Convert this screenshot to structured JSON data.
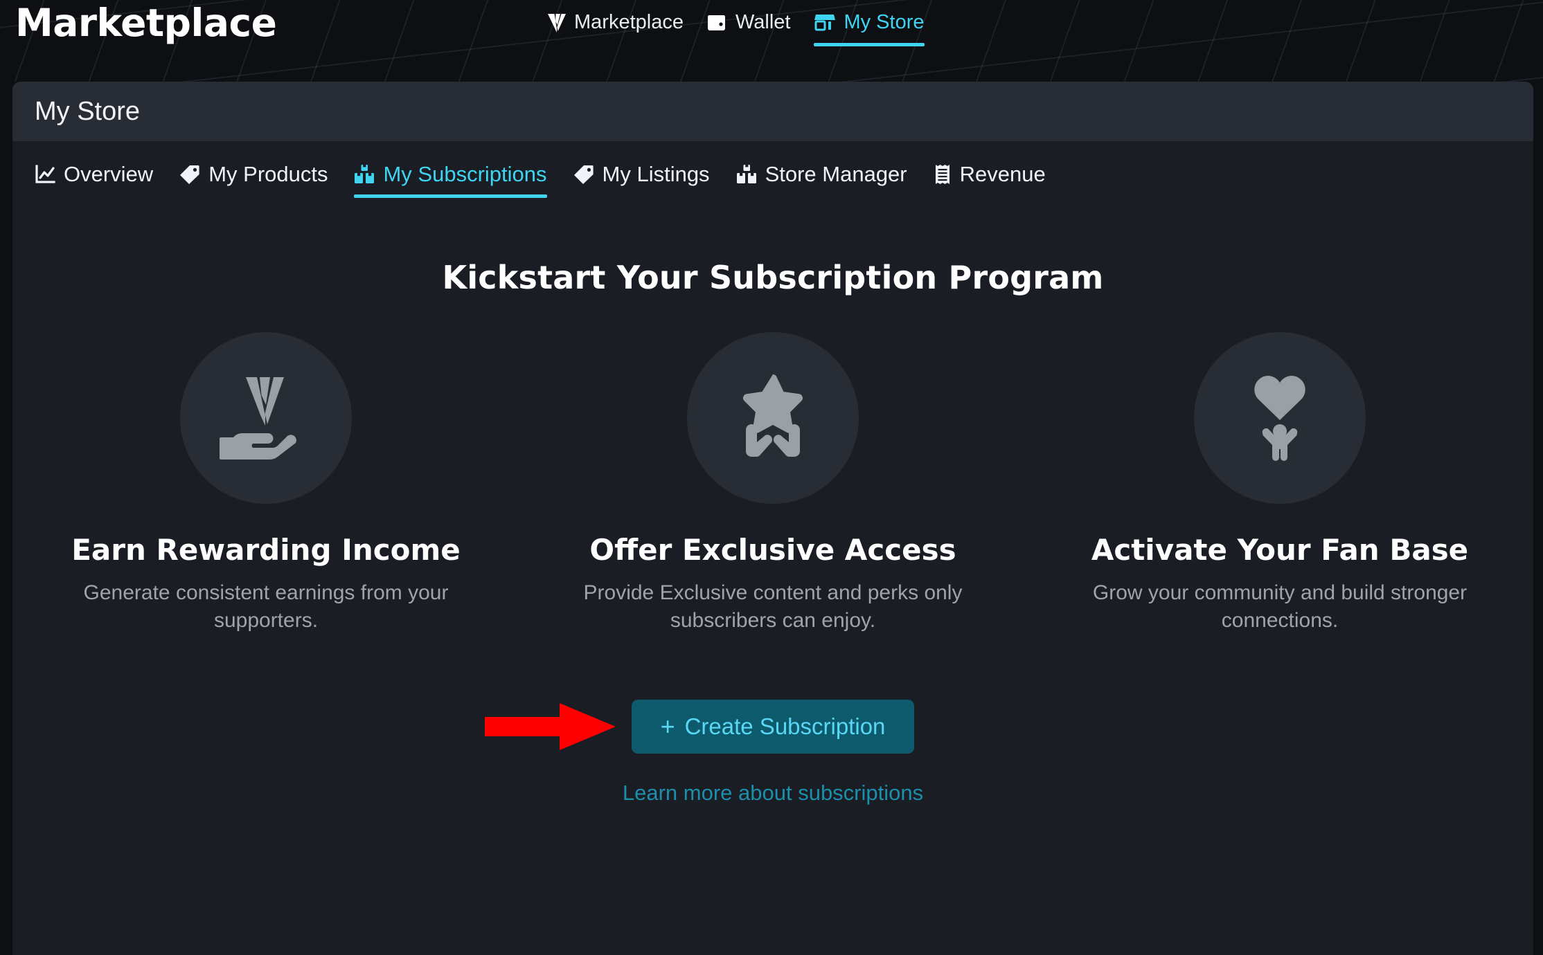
{
  "header": {
    "brand": "Marketplace",
    "nav": [
      {
        "label": "Marketplace",
        "icon": "v-logo-icon",
        "active": false
      },
      {
        "label": "Wallet",
        "icon": "wallet-icon",
        "active": false
      },
      {
        "label": "My Store",
        "icon": "storefront-icon",
        "active": true
      }
    ]
  },
  "panel": {
    "title": "My Store",
    "tabs": [
      {
        "label": "Overview",
        "icon": "chart-line-icon",
        "active": false
      },
      {
        "label": "My Products",
        "icon": "tag-icon",
        "active": false
      },
      {
        "label": "My Subscriptions",
        "icon": "boxes-icon",
        "active": true
      },
      {
        "label": "My Listings",
        "icon": "tag-icon",
        "active": false
      },
      {
        "label": "Store Manager",
        "icon": "boxes-icon",
        "active": false
      },
      {
        "label": "Revenue",
        "icon": "receipt-icon",
        "active": false
      }
    ]
  },
  "hero": {
    "title": "Kickstart Your Subscription Program",
    "features": [
      {
        "icon": "hand-holding-v-icon",
        "title": "Earn Rewarding Income",
        "desc": "Generate consistent earnings from your supporters."
      },
      {
        "icon": "hands-holding-star-icon",
        "title": "Offer Exclusive Access",
        "desc": "Provide Exclusive content and perks only subscribers can enjoy."
      },
      {
        "icon": "heart-person-icon",
        "title": "Activate Your Fan Base",
        "desc": "Grow your community and build stronger connections."
      }
    ],
    "cta_plus": "+",
    "cta_label": "Create Subscription",
    "learn_more": "Learn more about subscriptions"
  },
  "annotation": {
    "arrow": "red-right-arrow",
    "color": "#ff0000"
  },
  "colors": {
    "accent_cyan": "#3fd5f2",
    "link_teal": "#1b8fab",
    "cta_bg": "#0e5a6d",
    "panel_bg": "#1a1d23",
    "panel_head_bg": "#272c35",
    "page_bg": "#0d0f12",
    "muted_text": "#9ea4ac",
    "icon_gray": "#9ba0a7"
  }
}
